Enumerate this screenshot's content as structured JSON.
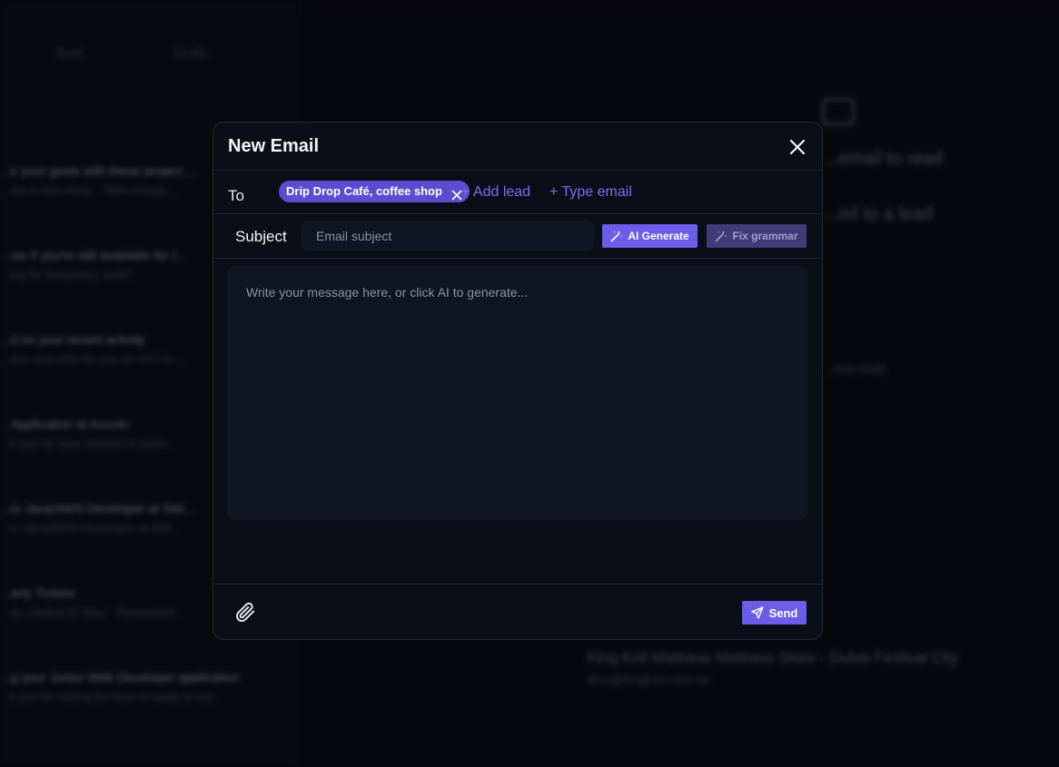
{
  "background": {
    "tabs": [
      "Sent",
      "Drafts"
    ],
    "list": [
      {
        "title": "...e your goals with these project ...",
        "snippet": "...ost a click away - Take charge..."
      },
      {
        "title": "...ow if you're still available for t...",
        "snippet": "...ing for temporary work?"
      },
      {
        "title": "...d on your recent activity",
        "snippet": "...ave new jobs for you on XYZ to..."
      },
      {
        "title": "...Application at Accolo",
        "snippet": "...k you for your interest in joinin..."
      },
      {
        "title": "...to Java/AWS Developer at Skil...",
        "snippet": "...to Java/AWS Developer at Skil..."
      },
      {
        "title": "...arty Tickets",
        "snippet": "...ey Limited 27 May - Renewals4..."
      },
      {
        "title": "...g your Junior Web Developer application",
        "snippet": "...k you for taking the time to apply to our..."
      }
    ],
    "main_line1": "...email to read",
    "main_line2": "...nd to a lead",
    "main_line3": "...rma Mall)",
    "main_footer_title": "King Koil Mattress Mattress Store - Dubai Festival City",
    "main_footer_sub": "dfcc@kingkoil.com.ae"
  },
  "modal": {
    "title": "New Email",
    "to_label": "To",
    "recipient_chip": "Drip Drop Café, coffee shop",
    "add_lead": "+ Add lead",
    "type_email": "+ Type email",
    "subject_label": "Subject",
    "subject_placeholder": "Email subject",
    "ai_generate": "AI Generate",
    "fix_grammar": "Fix grammar",
    "body_placeholder": "Write your message here, or click AI to generate...",
    "send": "Send"
  },
  "icons": {
    "close": "close-icon",
    "chip_remove": "x-icon",
    "ai": "magic-wand-icon",
    "fix": "magic-wand-icon",
    "attach": "paperclip-icon",
    "send": "paper-plane-icon"
  },
  "colors": {
    "accent": "#6c5ce7",
    "chip": "#5d4ccf",
    "link": "#7c6cf2",
    "modal_bg": "#0b0e17"
  }
}
